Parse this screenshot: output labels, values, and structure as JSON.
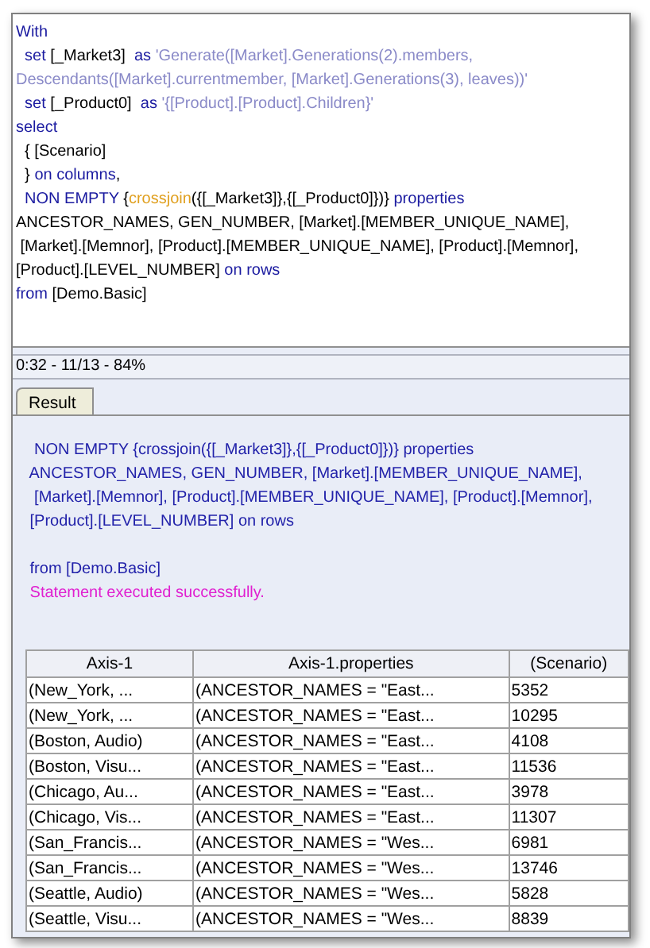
{
  "editor": {
    "lines": [
      [
        {
          "kind": "keyword",
          "text": "With"
        }
      ],
      [
        {
          "kind": "keyword",
          "text": "  set"
        },
        {
          "kind": "plain",
          "text": " [_Market3]  "
        },
        {
          "kind": "keyword",
          "text": "as"
        },
        {
          "kind": "string",
          "text": " 'Generate([Market].Generations(2).members,"
        }
      ],
      [
        {
          "kind": "string",
          "text": "Descendants([Market].currentmember, [Market].Generations(3), leaves))'"
        }
      ],
      [
        {
          "kind": "keyword",
          "text": "  set"
        },
        {
          "kind": "plain",
          "text": " [_Product0]  "
        },
        {
          "kind": "keyword",
          "text": "as"
        },
        {
          "kind": "string",
          "text": " '{[Product].[Product].Children}'"
        }
      ],
      [
        {
          "kind": "keyword",
          "text": "select"
        }
      ],
      [
        {
          "kind": "plain",
          "text": "  { [Scenario]"
        }
      ],
      [
        {
          "kind": "plain",
          "text": "  } "
        },
        {
          "kind": "keyword",
          "text": "on columns"
        },
        {
          "kind": "plain",
          "text": ","
        }
      ],
      [
        {
          "kind": "keyword",
          "text": "  NON EMPTY"
        },
        {
          "kind": "plain",
          "text": " {"
        },
        {
          "kind": "function",
          "text": "crossjoin"
        },
        {
          "kind": "plain",
          "text": "({[_Market3]},{[_Product0]})} "
        },
        {
          "kind": "keyword",
          "text": "properties"
        }
      ],
      [
        {
          "kind": "plain",
          "text": "ANCESTOR_NAMES, GEN_NUMBER, [Market].[MEMBER_UNIQUE_NAME],"
        }
      ],
      [
        {
          "kind": "plain",
          "text": " [Market].[Memnor], [Product].[MEMBER_UNIQUE_NAME], [Product].[Memnor],"
        }
      ],
      [
        {
          "kind": "plain",
          "text": "[Product].[LEVEL_NUMBER] "
        },
        {
          "kind": "keyword",
          "text": "on rows"
        }
      ],
      [
        {
          "kind": "keyword",
          "text": "from"
        },
        {
          "kind": "plain",
          "text": " [Demo.Basic]"
        }
      ]
    ]
  },
  "status_bar": "0:32 - 11/13 - 84%",
  "tabs": [
    {
      "label": "Result",
      "selected": true
    }
  ],
  "result": {
    "lines": [
      {
        "kind": "echo",
        "text": "  NON EMPTY {crossjoin({[_Market3]},{[_Product0]})} properties"
      },
      {
        "kind": "echo",
        "text": " ANCESTOR_NAMES, GEN_NUMBER, [Market].[MEMBER_UNIQUE_NAME],"
      },
      {
        "kind": "echo",
        "text": "  [Market].[Memnor], [Product].[MEMBER_UNIQUE_NAME], [Product].[Memnor],"
      },
      {
        "kind": "echo",
        "text": " [Product].[LEVEL_NUMBER] on rows"
      },
      {
        "kind": "blank"
      },
      {
        "kind": "echo",
        "text": " from [Demo.Basic]"
      },
      {
        "kind": "message",
        "text": " Statement executed successfully."
      }
    ]
  },
  "table": {
    "columns": [
      "Axis-1",
      "Axis-1.properties",
      "(Scenario)"
    ],
    "rows": [
      [
        "(New_York, ...",
        "(ANCESTOR_NAMES = \"East...",
        "5352"
      ],
      [
        "(New_York, ...",
        "(ANCESTOR_NAMES = \"East...",
        "10295"
      ],
      [
        "(Boston, Audio)",
        "(ANCESTOR_NAMES = \"East...",
        "4108"
      ],
      [
        "(Boston, Visu...",
        "(ANCESTOR_NAMES = \"East...",
        "11536"
      ],
      [
        "(Chicago, Au...",
        "(ANCESTOR_NAMES = \"East...",
        "3978"
      ],
      [
        "(Chicago, Vis...",
        "(ANCESTOR_NAMES = \"East...",
        "11307"
      ],
      [
        "(San_Francis...",
        "(ANCESTOR_NAMES = \"Wes...",
        "6981"
      ],
      [
        "(San_Francis...",
        "(ANCESTOR_NAMES = \"Wes...",
        "13746"
      ],
      [
        "(Seattle, Audio)",
        "(ANCESTOR_NAMES = \"Wes...",
        "5828"
      ],
      [
        "(Seattle, Visu...",
        "(ANCESTOR_NAMES = \"Wes...",
        "8839"
      ]
    ]
  }
}
